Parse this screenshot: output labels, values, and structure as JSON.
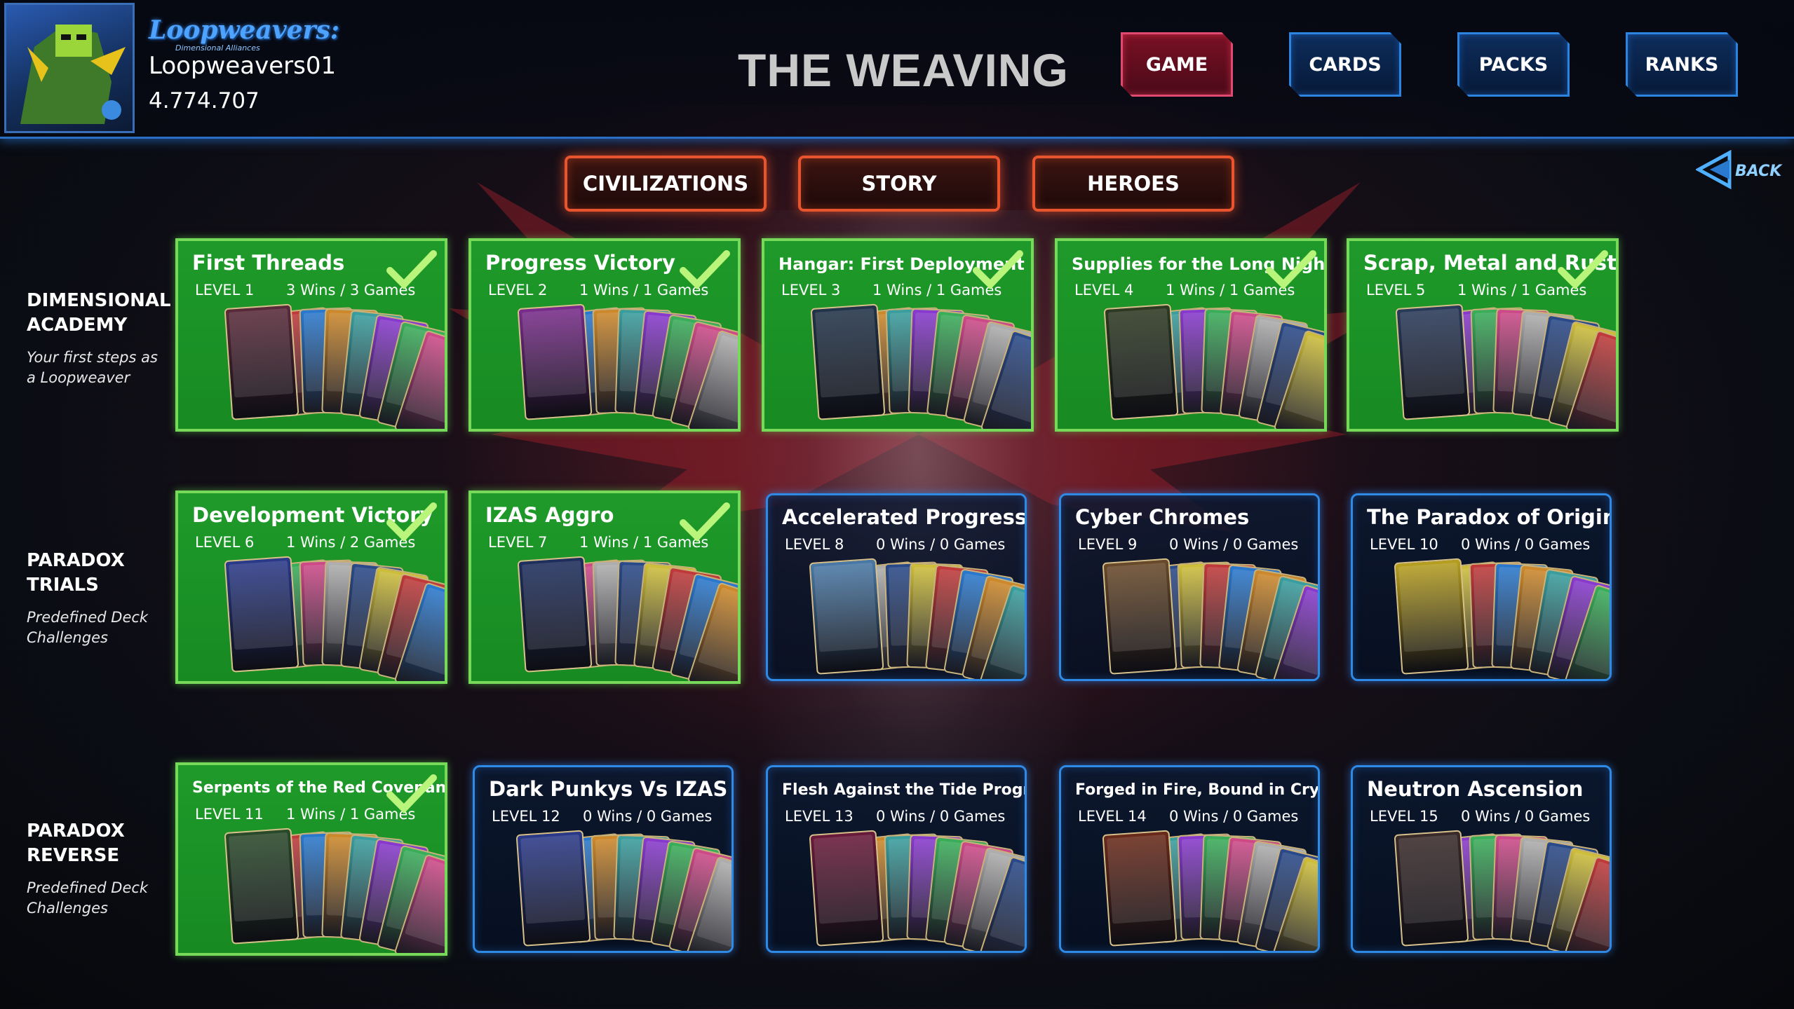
{
  "colors": {
    "complete": "#1f9a2a",
    "open_border": "#2f8ae6",
    "nav_active": "#7a1024",
    "nav_inactive": "#0d2d5c",
    "tab_border": "#e8542e"
  },
  "header": {
    "logo": "Loopweavers:",
    "logo_sub": "Dimensional Alliances",
    "username": "Loopweavers01",
    "score": "4.774.707",
    "title": "THE WEAVING",
    "avatar_icon": "alien-hero-avatar",
    "nav": [
      {
        "label": "GAME",
        "active": true
      },
      {
        "label": "CARDS",
        "active": false
      },
      {
        "label": "PACKS",
        "active": false
      },
      {
        "label": "RANKS",
        "active": false
      }
    ]
  },
  "tabs": [
    {
      "label": "CIVILIZATIONS"
    },
    {
      "label": "STORY"
    },
    {
      "label": "HEROES"
    }
  ],
  "back": {
    "label": "BACK",
    "icon": "back-arrow-icon"
  },
  "rows": [
    {
      "title": "DIMENSIONAL ACADEMY",
      "subtitle": "Your first steps as a Loopweaver"
    },
    {
      "title": "PARADOX TRIALS",
      "subtitle": "Predefined Deck Challenges"
    },
    {
      "title": "PARADOX REVERSE",
      "subtitle": "Predefined Deck Challenges"
    }
  ],
  "levels": [
    {
      "name": "First Threads",
      "level": "LEVEL 1",
      "record": "3 Wins / 3 Games",
      "completed": true,
      "hero": "#5a2a3a"
    },
    {
      "name": "Progress Victory",
      "level": "LEVEL 2",
      "record": "1 Wins / 1 Games",
      "completed": true,
      "hero": "#7a2c8c"
    },
    {
      "name": "Hangar: First Deployment",
      "level": "LEVEL 3",
      "record": "1 Wins / 1 Games",
      "completed": true,
      "hero": "#22344a"
    },
    {
      "name": "Supplies for the Long Night",
      "level": "LEVEL 4",
      "record": "1 Wins / 1 Games",
      "completed": true,
      "hero": "#2e3a22"
    },
    {
      "name": "Scrap, Metal and Rust",
      "level": "LEVEL 5",
      "record": "1 Wins / 1 Games",
      "completed": true,
      "hero": "#2a3a5a"
    },
    {
      "name": "Development Victory",
      "level": "LEVEL 6",
      "record": "1 Wins / 2 Games",
      "completed": true,
      "hero": "#2a3a8a"
    },
    {
      "name": "IZAS Aggro",
      "level": "LEVEL 7",
      "record": "1 Wins / 1 Games",
      "completed": true,
      "hero": "#1e2e5e"
    },
    {
      "name": "Accelerated Progress",
      "level": "LEVEL 8",
      "record": "0 Wins / 0 Games",
      "completed": false,
      "hero": "#4a7aa8"
    },
    {
      "name": "Cyber Chromes",
      "level": "LEVEL 9",
      "record": "0 Wins / 0 Games",
      "completed": false,
      "hero": "#6a4a2a"
    },
    {
      "name": "The Paradox of Origin",
      "level": "LEVEL 10",
      "record": "0 Wins / 0 Games",
      "completed": false,
      "hero": "#b8a020"
    },
    {
      "name": "Serpents of the Red Covenant",
      "level": "LEVEL 11",
      "record": "1 Wins / 1 Games",
      "completed": true,
      "hero": "#2a4a2a"
    },
    {
      "name": "Dark Punkys Vs IZAS",
      "level": "LEVEL 12",
      "record": "0 Wins / 0 Games",
      "completed": false,
      "hero": "#2a3a8a"
    },
    {
      "name": "Flesh Against the Tide Progress",
      "level": "LEVEL 13",
      "record": "0 Wins / 0 Games",
      "completed": false,
      "hero": "#6a1a3a"
    },
    {
      "name": "Forged in Fire, Bound in Crystal",
      "level": "LEVEL 14",
      "record": "0 Wins / 0 Games",
      "completed": false,
      "hero": "#6a2a1a"
    },
    {
      "name": "Neutron Ascension",
      "level": "LEVEL 15",
      "record": "0 Wins / 0 Games",
      "completed": false,
      "hero": "#3a2a2a"
    }
  ]
}
